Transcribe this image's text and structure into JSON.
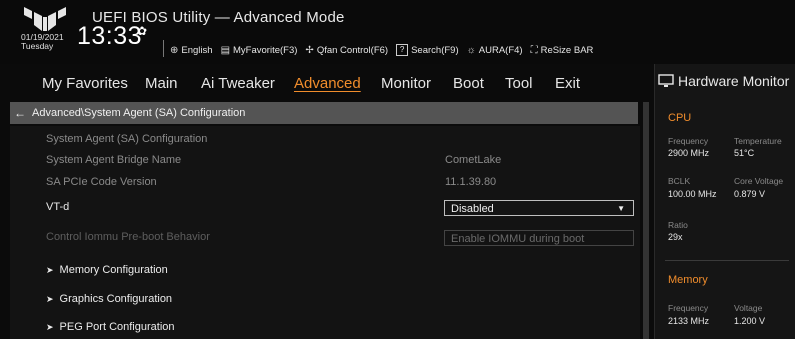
{
  "header": {
    "title": "UEFI BIOS Utility — Advanced Mode",
    "date": "01/19/2021",
    "day": "Tuesday",
    "time": "13:33",
    "toolbar": [
      {
        "icon": "globe-icon",
        "glyph": "⊕",
        "label": "English"
      },
      {
        "icon": "myfavorite-icon",
        "glyph": "▤",
        "label": "MyFavorite(F3)"
      },
      {
        "icon": "fan-icon",
        "glyph": "✢",
        "label": "Qfan Control(F6)"
      },
      {
        "icon": "search-icon",
        "glyph": "?",
        "label": "Search(F9)"
      },
      {
        "icon": "aura-icon",
        "glyph": "☼",
        "label": "AURA(F4)"
      },
      {
        "icon": "resizebar-icon",
        "glyph": "⛶",
        "label": "ReSize BAR"
      }
    ]
  },
  "menu": [
    "My Favorites",
    "Main",
    "Ai Tweaker",
    "Advanced",
    "Monitor",
    "Boot",
    "Tool",
    "Exit"
  ],
  "active_menu": "Advanced",
  "breadcrumb": "Advanced\\System Agent (SA) Configuration",
  "rows": {
    "r0": {
      "label": "System Agent (SA) Configuration"
    },
    "r1": {
      "label": "System Agent Bridge Name",
      "value": "CometLake"
    },
    "r2": {
      "label": "SA PCIe Code Version",
      "value": "11.1.39.80"
    },
    "r3": {
      "label": "VT-d",
      "value": "Disabled"
    },
    "r4": {
      "label": "Control Iommu Pre-boot Behavior",
      "value": "Enable IOMMU during boot"
    }
  },
  "submenus": [
    "Memory Configuration",
    "Graphics Configuration",
    "PEG Port Configuration"
  ],
  "hardware_monitor": {
    "title": "Hardware Monitor",
    "cpu": {
      "heading": "CPU",
      "frequency_label": "Frequency",
      "frequency": "2900 MHz",
      "temperature_label": "Temperature",
      "temperature": "51°C",
      "bclk_label": "BCLK",
      "bclk": "100.00 MHz",
      "core_voltage_label": "Core Voltage",
      "core_voltage": "0.879 V",
      "ratio_label": "Ratio",
      "ratio": "29x"
    },
    "memory": {
      "heading": "Memory",
      "frequency_label": "Frequency",
      "frequency": "2133 MHz",
      "voltage_label": "Voltage",
      "voltage": "1.200 V"
    }
  },
  "colors": {
    "accent": "#f18d2c",
    "breadcrumb_bg": "#545454",
    "background": "#0b0b0b"
  }
}
